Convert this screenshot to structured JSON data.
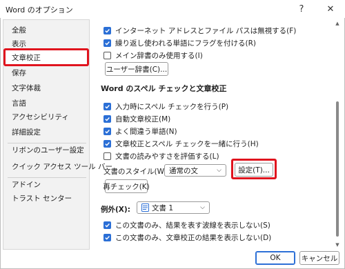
{
  "window": {
    "title": "Word のオプション",
    "help_glyph": "?",
    "close_glyph": "✕"
  },
  "sidebar": {
    "items": [
      {
        "label": "全般"
      },
      {
        "label": "表示"
      },
      {
        "label": "文章校正"
      },
      {
        "label": "保存"
      },
      {
        "label": "文字体裁"
      },
      {
        "label": "言語"
      },
      {
        "label": "アクセシビリティ"
      },
      {
        "label": "詳細設定"
      },
      {
        "label": "リボンのユーザー設定"
      },
      {
        "label": "クイック アクセス ツール バー"
      },
      {
        "label": "アドイン"
      },
      {
        "label": "トラスト センター"
      }
    ],
    "selected_index": 2
  },
  "top_options": [
    {
      "label": "インターネット アドレスとファイル パスは無視する(F)",
      "checked": true
    },
    {
      "label": "繰り返し使われる単語にフラグを付ける(R)",
      "checked": true
    },
    {
      "label": "メイン辞書のみ使用する(I)",
      "checked": false
    }
  ],
  "custom_dictionary_button": "ユーザー辞書(C)...",
  "spell_section": {
    "title": "Word のスペル チェックと文章校正",
    "options": [
      {
        "label": "入力時にスペル チェックを行う(P)",
        "checked": true
      },
      {
        "label": "自動文章校正(M)",
        "checked": true
      },
      {
        "label": "よく間違う単語(N)",
        "checked": true
      },
      {
        "label": "文章校正とスペル チェックを一緒に行う(H)",
        "checked": true
      },
      {
        "label": "文書の読みやすさを評価する(L)",
        "checked": false
      }
    ],
    "writing_style_label": "文書のスタイル(W):",
    "writing_style_value": "通常の文",
    "settings_button": "設定(T)...",
    "recheck_button": "再チェック(K)"
  },
  "exceptions": {
    "label": "例外(X):",
    "document_value": "文書 1",
    "options": [
      {
        "label": "この文書のみ、結果を表す波線を表示しない(S)",
        "checked": true
      },
      {
        "label": "この文書のみ、文章校正の結果を表示しない(D)",
        "checked": true
      }
    ]
  },
  "footer": {
    "ok_label": "OK",
    "cancel_label": "キャンセル"
  },
  "colors": {
    "accent": "#2b6fd6",
    "highlight": "#e0141e"
  },
  "icons": {
    "help": "help-icon",
    "close": "close-icon",
    "checkbox_checked": "checkmark-icon",
    "dropdown": "chevron-down-icon",
    "document": "document-icon"
  }
}
